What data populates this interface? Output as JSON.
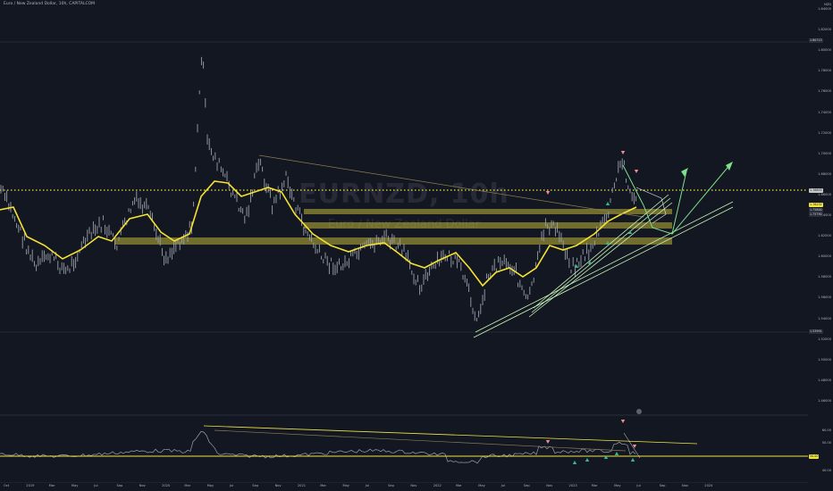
{
  "header": {
    "title": "Euro / New Zealand Dollar, 10h, CAPITALCOM"
  },
  "watermark": {
    "symbol": "EURNZD, 10h",
    "name": "Euro / New Zealand Dollar"
  },
  "price_axis": {
    "currency": "NZD",
    "ticks": [
      "1.84000",
      "1.82000",
      "1.80000",
      "1.78000",
      "1.76000",
      "1.74000",
      "1.72000",
      "1.70000",
      "1.68000",
      "1.66000",
      "1.64000",
      "1.62000",
      "1.60000",
      "1.58000",
      "1.56000",
      "1.54000",
      "1.52000",
      "1.50000",
      "1.48000",
      "1.46000"
    ],
    "high_label": "High",
    "high_value": "1.80713",
    "low_label": "Low",
    "low_value": "1.53991",
    "last_price": "1.76893",
    "ma_value": "1.76232",
    "tag_value_a": "1.75800",
    "tag_value_b": "1.75790"
  },
  "oscillator_axis": {
    "ticks": [
      "60.00",
      "50.00",
      "40.00"
    ],
    "current": "50.00"
  },
  "time_axis": {
    "ticks": [
      "Oct",
      "2019",
      "Mar",
      "May",
      "Jul",
      "Sep",
      "Nov",
      "2020",
      "Mar",
      "May",
      "Jul",
      "Sep",
      "Nov",
      "2021",
      "Mar",
      "May",
      "Jul",
      "Sep",
      "Nov",
      "2022",
      "Mar",
      "May",
      "Jul",
      "Sep",
      "Nov",
      "2023",
      "Mar",
      "May",
      "Jul",
      "Sep",
      "Nov",
      "2024"
    ]
  },
  "colors": {
    "background": "#131722",
    "candles": "#9aa0ac",
    "moving_average": "#f5e233",
    "zones": "#f0e442",
    "dotted_level": "#f0e442",
    "trend_lines": "#c8f5b8",
    "projection": "#7ee08a",
    "resistance": "#8a7b52",
    "arrow_down": "#f08b95",
    "arrow_up": "#38b98d"
  },
  "icons": [
    "arrow-up-icon",
    "arrow-down-icon",
    "settings-dot-icon"
  ]
}
